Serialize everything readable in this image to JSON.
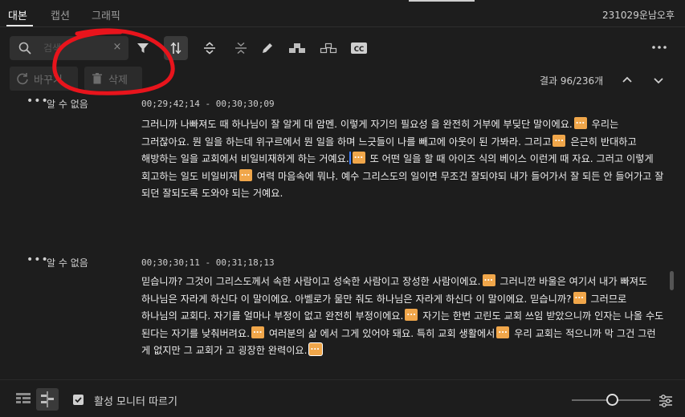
{
  "tabs": [
    "대본",
    "캡션",
    "그래픽"
  ],
  "project_name": "231029운남오후",
  "search": {
    "placeholder": "검색",
    "clear": "×"
  },
  "buttons": {
    "replace": "바꾸기",
    "delete": "삭제"
  },
  "results": "결과 96/236개",
  "blocks": [
    {
      "speaker": "알 수 없음",
      "timecode": "00;29;42;14 - 00;30;30;09",
      "segments": [
        "그러니까 나빠져도 때 하나님이 잘 알게 대 암멘. 이렇게 자기의 필요성 을 완전히 거부에 부딪단 말이에요.",
        " 우리는 그러잖아요. 뭔 일을 하는데 위구르에서 뭔 일을 하며 느긋들이 나를 빼고에 아웃이 된 가봐라. 그리고",
        " 은근히 반대하고 해방하는 일을 교회에서 비일비재하게 하는 거예요.",
        " 또 어떤 일을 할 때 아이즈 식의 베이스 이런게 때 자요. 그러고 이렇게 회고하는 일도 비일비재",
        " 여력 마음속에 뭐냐. 예수 그리스도의 일이면 무조건 잘되야되 내가 들어가서 잘 되든 안 들어가고 잘 되던 잘되도록 도와야 되는 거예요."
      ]
    },
    {
      "speaker": "알 수 없음",
      "timecode": "00;30;30;11 - 00;31;18;13",
      "segments": [
        "믿습니까? 그것이 그리스도께서 속한 사람이고 성숙한 사람이고 장성한 사람이에요.",
        " 그러니깐 바울은 여기서 내가 빠져도 하나님은 자라게 하신다 이 말이에요. 아벨로가 물만 줘도 하나님은 자라게 하신다 이 말이에요. 믿습니까?",
        " 그러므로 하나님의 교회다. 자기를 얼마나 부정이 없고 완전히 부정이에요.",
        " 자기는 한번 고린도 교회 쓰임 받았으니까 인자는 나올 수도 된다는 자기를 낮춰버려요.",
        " 여러분의 삶 에서 그게 있어야 돼요. 특히 교회 생활에서",
        " 우리 교회는 적으니까 막 그건 그런 게 없지만 그 교회가 고 굉장한 완력이요."
      ]
    }
  ],
  "bottom": {
    "follow_label": "활성 모니터 따르기",
    "follow_checked": true
  },
  "colors": {
    "marker": "#f0a64a",
    "annotation": "#e8141c",
    "background": "#1d1d1d"
  },
  "icons": [
    "search-icon",
    "filter-icon",
    "split-icon",
    "merge-icon",
    "unmerge-icon",
    "pencil-icon",
    "speaker-group-icon",
    "speaker-group-outline-icon",
    "cc-icon",
    "more-icon",
    "refresh-icon",
    "trash-icon",
    "chevron-up-icon",
    "chevron-down-icon",
    "settings-sliders-icon"
  ]
}
